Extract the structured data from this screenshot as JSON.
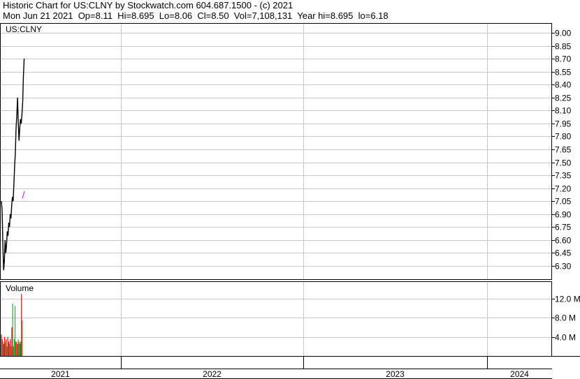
{
  "header": {
    "line1": "Historic Chart for US:CLNY by Stockwatch.com 604.687.1500 - (c) 2021",
    "line2": "Mon Jun 21 2021  Op=8.11  Hi=8.695  Lo=8.06  Cl=8.50  Vol=7,108,131  Year hi=8.695  lo=6.18"
  },
  "chart_data": [
    {
      "type": "line",
      "title": "US:CLNY",
      "ylim": [
        6.15,
        9.1
      ],
      "y_ticks": [
        "9.00",
        "8.85",
        "8.70",
        "8.55",
        "8.40",
        "8.25",
        "8.10",
        "7.95",
        "7.80",
        "7.65",
        "7.50",
        "7.35",
        "7.20",
        "7.05",
        "6.90",
        "6.75",
        "6.60",
        "6.45",
        "6.30"
      ],
      "x_categories": [
        "2021",
        "2022",
        "2023",
        "2024"
      ],
      "grid": true,
      "series": [
        {
          "values": [
            7.05,
            6.95,
            6.55,
            6.25,
            6.35,
            6.6,
            6.45,
            6.55,
            6.7,
            6.65,
            6.8,
            6.75,
            6.9,
            6.85,
            7.0,
            7.1,
            7.05,
            7.25,
            7.45,
            7.6,
            7.9,
            8.05,
            8.25,
            7.95,
            7.75,
            7.9,
            8.0,
            7.95,
            8.05,
            8.2,
            8.5,
            8.7
          ]
        }
      ],
      "colors": {
        "price": "#000000",
        "marker": "#cc00cc"
      }
    },
    {
      "type": "bar",
      "title": "Volume",
      "ylim": [
        0,
        14.5
      ],
      "y_ticks": [
        "12.0 M",
        "8.0 M",
        "4.0 M"
      ],
      "values": [
        4.5,
        3.5,
        3.0,
        2.5,
        4.0,
        3.0,
        3.5,
        2.0,
        4.0,
        3.0,
        2.5,
        3.5,
        2.0,
        6.0,
        11.0,
        2.0,
        3.5,
        10.5,
        3.0,
        3.0,
        2.5,
        3.5,
        3.0,
        2.5,
        3.0,
        13.0,
        7.5
      ],
      "up_down": [
        "d",
        "d",
        "u",
        "d",
        "d",
        "u",
        "d",
        "u",
        "d",
        "d",
        "u",
        "d",
        "u",
        "d",
        "u",
        "d",
        "u",
        "u",
        "d",
        "u",
        "d",
        "u",
        "d",
        "u",
        "d",
        "d",
        "u"
      ],
      "colors": {
        "up": "#33aa33",
        "down": "#dd1111"
      }
    }
  ]
}
